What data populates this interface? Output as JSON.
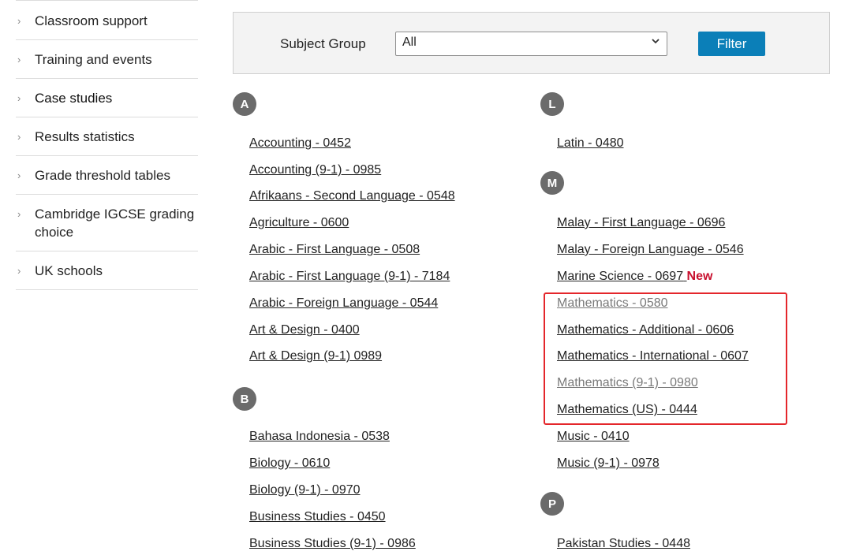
{
  "sidebar": {
    "items": [
      {
        "label": "Classroom support"
      },
      {
        "label": "Training and events"
      },
      {
        "label": "Case studies"
      },
      {
        "label": "Results statistics"
      },
      {
        "label": "Grade threshold tables"
      },
      {
        "label": "Cambridge IGCSE grading choice"
      },
      {
        "label": "UK schools"
      }
    ],
    "chevron": "›"
  },
  "filter": {
    "label": "Subject Group",
    "selected": "All",
    "button": "Filter"
  },
  "groups": {
    "A": {
      "letter": "A",
      "subjects": [
        "Accounting - 0452",
        "Accounting (9-1) - 0985",
        "Afrikaans - Second Language - 0548",
        "Agriculture - 0600",
        "Arabic - First Language - 0508",
        "Arabic - First Language (9-1) - 7184",
        "Arabic - Foreign Language - 0544",
        "Art & Design - 0400",
        "Art & Design (9-1) 0989"
      ]
    },
    "B": {
      "letter": "B",
      "subjects": [
        "Bahasa Indonesia - 0538",
        "Biology - 0610",
        "Biology (9-1) - 0970",
        "Business Studies - 0450",
        "Business Studies (9-1) - 0986"
      ]
    },
    "L": {
      "letter": "L",
      "subjects": [
        "Latin - 0480"
      ]
    },
    "M": {
      "letter": "M",
      "subjects": [
        "Malay - First Language - 0696",
        "Malay - Foreign Language - 0546",
        "Marine Science - 0697",
        "Mathematics - 0580",
        "Mathematics - Additional - 0606",
        "Mathematics - International - 0607",
        "Mathematics (9-1) - 0980",
        "Mathematics (US) - 0444",
        "Music - 0410",
        "Music (9-1) - 0978"
      ],
      "new_badge": "New"
    },
    "P": {
      "letter": "P",
      "subjects": [
        "Pakistan Studies - 0448"
      ]
    }
  },
  "colors": {
    "letter_circle": "#6b6b6b",
    "filter_button": "#0b7fb8",
    "new_badge": "#c8102e",
    "highlight_box": "#e4262b"
  }
}
